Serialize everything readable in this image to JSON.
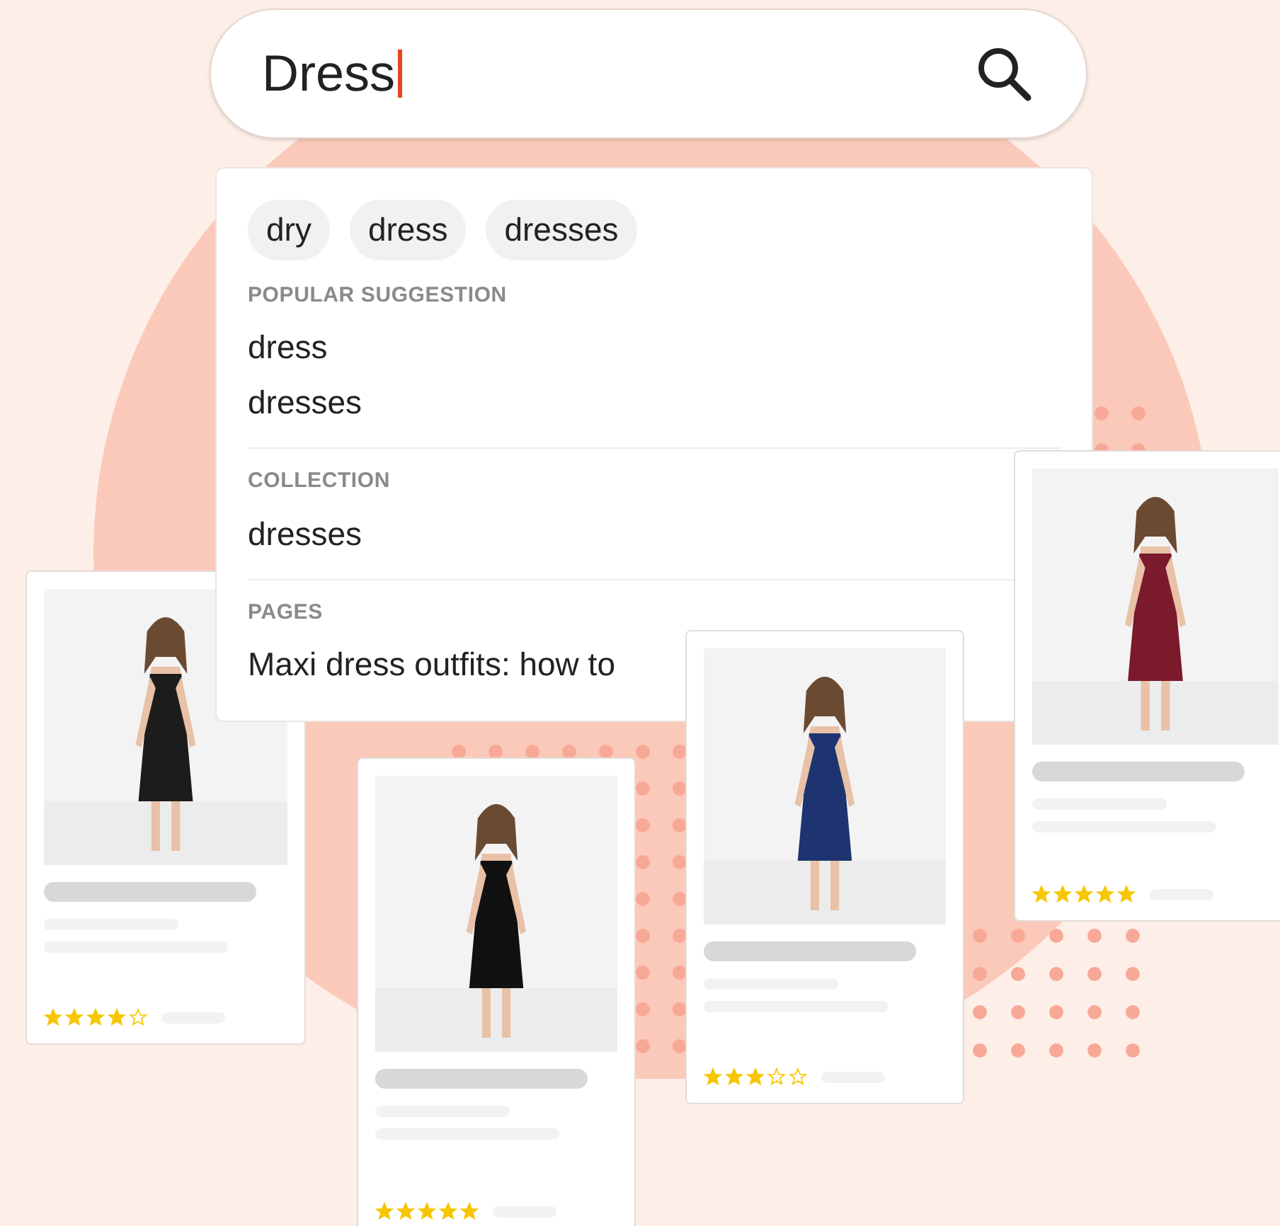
{
  "search": {
    "value": "Dress"
  },
  "chips": [
    "dry",
    "dress",
    "dresses"
  ],
  "sections": [
    {
      "heading": "POPULAR SUGGESTION",
      "items": [
        "dress",
        "dresses"
      ]
    },
    {
      "heading": "COLLECTION",
      "items": [
        "dresses"
      ]
    },
    {
      "heading": "PAGES",
      "items": [
        "Maxi dress outfits: how to"
      ]
    }
  ],
  "products": [
    {
      "stars": 4
    },
    {
      "stars": 5
    },
    {
      "stars": 3
    },
    {
      "stars": 5
    }
  ]
}
